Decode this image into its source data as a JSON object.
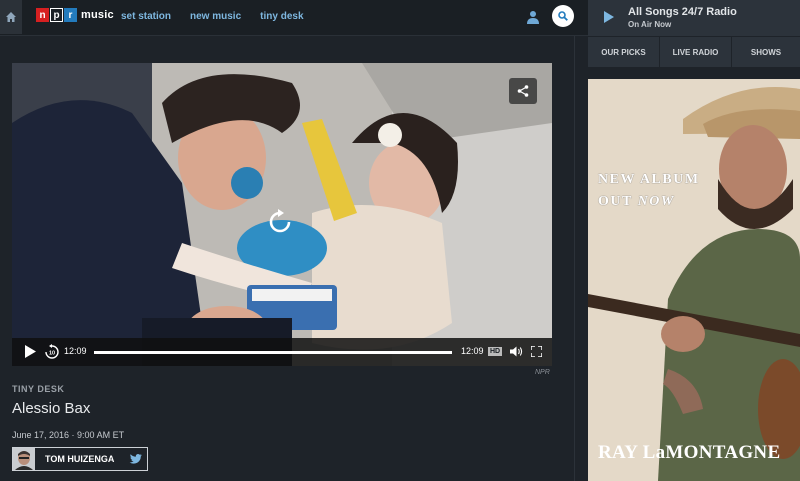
{
  "nav": {
    "logo_letters": [
      "n",
      "p",
      "r"
    ],
    "logo_word": "music",
    "links": [
      "set station",
      "new music",
      "tiny desk"
    ],
    "icons": [
      "home-icon",
      "user-icon",
      "search-icon"
    ]
  },
  "video": {
    "current_time": "12:09",
    "duration": "12:09",
    "progress": 1.0,
    "hd_label": "HD",
    "credit": "NPR",
    "icons": [
      "share-icon",
      "replay-icon",
      "play-icon",
      "rewind-10-icon",
      "volume-icon",
      "fullscreen-icon"
    ]
  },
  "story": {
    "kicker": "TINY DESK",
    "title": "Alessio Bax",
    "date": "June 17, 2016 · 9:00 AM ET",
    "author": "TOM HUIZENGA"
  },
  "player": {
    "station": "All Songs 24/7 Radio",
    "status": "On Air Now"
  },
  "sidebar_tabs": [
    "OUR PICKS",
    "LIVE RADIO",
    "SHOWS"
  ],
  "ad": {
    "line1": "NEW ALBUM",
    "line2_a": "OUT ",
    "line2_b": "NOW",
    "artist": "RAY LaMONTAGNE"
  },
  "colors": {
    "background": "#1e2329",
    "nav_link": "#7eb7e0",
    "npr_red": "#d62021",
    "npr_blue": "#237bbd"
  }
}
